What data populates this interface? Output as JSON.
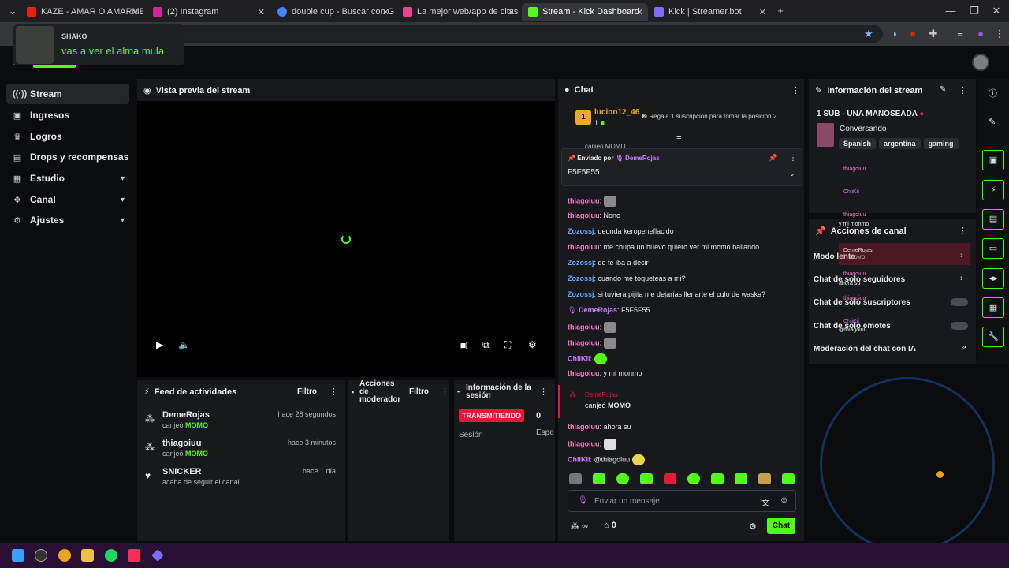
{
  "browser": {
    "tabs": [
      {
        "label": "KAZE - AMAR O AMARME [PRO",
        "color": "#e62117"
      },
      {
        "label": "(2) Instagram",
        "color": "#d6249f"
      },
      {
        "label": "double cup - Buscar con Googl",
        "color": "#4285f4"
      },
      {
        "label": "La mejor web/app de citas grat",
        "color": "#e84393"
      },
      {
        "label": "Stream - Kick Dashboard",
        "color": "#53fc18"
      },
      {
        "label": "Kick | Streamer.bot",
        "color": "#7c6cf7"
      }
    ]
  },
  "notification": {
    "user": "SHAKO",
    "message": "vas a ver el alma mula"
  },
  "sidebar": {
    "items": [
      {
        "label": "Stream",
        "icon": "broadcast-icon"
      },
      {
        "label": "Ingresos",
        "icon": "wallet-icon"
      },
      {
        "label": "Logros",
        "icon": "trophy-icon"
      },
      {
        "label": "Drops y recompensas",
        "icon": "gift-icon"
      },
      {
        "label": "Estudio",
        "icon": "studio-icon"
      },
      {
        "label": "Canal",
        "icon": "channel-icon"
      },
      {
        "label": "Ajustes",
        "icon": "gear-icon"
      }
    ]
  },
  "preview": {
    "title": "Vista previa del stream"
  },
  "feed": {
    "title": "Feed de actividades",
    "filter": "Filtro",
    "rows": [
      {
        "name": "DemeRojas",
        "action": "canjeó",
        "reward": "MOMO",
        "time": "hace 28 segundos"
      },
      {
        "name": "thiagoiuu",
        "action": "canjeó",
        "reward": "MOMO",
        "time": "hace 3 minutos"
      },
      {
        "name": "SNICKER",
        "action": "acaba de seguir el canal",
        "reward": "",
        "time": "hace 1 día"
      }
    ]
  },
  "mod_actions": {
    "title_1": "Acciones",
    "title_2": "de",
    "title_3": "moderador",
    "filter": "Filtro"
  },
  "session": {
    "title_1": "Información de la",
    "title_2": "sesión",
    "status": "TRANSMITIENDO",
    "count": "0",
    "label": "Sesión",
    "extra": "Espe"
  },
  "chat": {
    "title": "Chat",
    "top_user": "lucioo12_46",
    "top_rank": "1",
    "top_count": "1",
    "gift_prompt": "Regala 1 suscripción para tomar la posición 2",
    "partial_top": "canjeó MOMO",
    "pinned_by_label": "Enviado por",
    "pinned_by": "DemeRojas",
    "pinned_message": "F5F5F55",
    "messages": [
      {
        "user": "thiagoiuu",
        "text": "",
        "color": "pink",
        "emote": "#8a8a8a"
      },
      {
        "user": "thiagoiuu",
        "text": "Nono",
        "color": "pink",
        "emote": ""
      },
      {
        "user": "Zozossj",
        "text": "qeonda keropeneflacido",
        "color": "blue",
        "emote": ""
      },
      {
        "user": "thiagoiuu",
        "text": "me chupa un huevo quiero ver mi momo bailando",
        "color": "pink",
        "emote": ""
      },
      {
        "user": "Zozossj",
        "text": "qe te iba a decir",
        "color": "blue",
        "emote": ""
      },
      {
        "user": "Zozossj",
        "text": "cuando me toqueteas a mi?",
        "color": "blue",
        "emote": ""
      },
      {
        "user": "Zozossj",
        "text": "si tuviera pijita me dejarías llenarte el culo de waska?",
        "color": "blue",
        "emote": ""
      },
      {
        "user": "DemeRojas",
        "text": "F5F5F55",
        "color": "purple",
        "emote": ""
      },
      {
        "user": "thiagoiuu",
        "text": "",
        "color": "pink",
        "emote": "#8a8a8a"
      },
      {
        "user": "thiagoiuu",
        "text": "",
        "color": "pink",
        "emote": "#8a8a8a"
      },
      {
        "user": "ChiiKii",
        "text": "",
        "color": "purple",
        "emote": "#53fc18"
      },
      {
        "user": "thiagoiuu",
        "text": "y mi monmo",
        "color": "pink",
        "emote": ""
      }
    ],
    "redeem": {
      "user": "DemeRojas",
      "action": "canjeó",
      "reward": "MOMO"
    },
    "messages2": [
      {
        "user": "thiagoiuu",
        "text": "ahora su",
        "color": "pink",
        "emote": ""
      },
      {
        "user": "thiagoiuu",
        "text": "",
        "color": "pink",
        "emote": "#dddddd"
      },
      {
        "user": "ChiiKii",
        "text": "@thiagoiuu",
        "color": "purple",
        "emote": "#e6d64a"
      }
    ],
    "input_placeholder": "Enviar un mensaje",
    "viewers": "∞",
    "store_count": "0",
    "send_label": "Chat"
  },
  "stream_info": {
    "title": "Información del stream",
    "stream_title": "1 SUB - UNA MANOSEADA",
    "category": "Conversando",
    "tags": [
      "Spanish",
      "argentina",
      "gaming"
    ]
  },
  "channel_actions": {
    "title": "Acciones de canal",
    "rows": [
      "Modo lento",
      "Chat de solo seguidores",
      "Chat de solo suscriptores",
      "Chat de solo emotes",
      "Moderación del chat con IA"
    ]
  },
  "overlay_chat": [
    {
      "user": "thiagoiuu",
      "text": ""
    },
    {
      "user": "ChiiKii",
      "text": ""
    },
    {
      "user": "thiagoiuu",
      "text": "y mi monmo"
    },
    {
      "user": "DemeRojas",
      "text": "MOMO"
    },
    {
      "user": "thiagoiuu",
      "text": "ahora su"
    },
    {
      "user": "thiagoiuu",
      "text": ""
    },
    {
      "user": "ChiiKii",
      "text": "@thiagoiuu"
    }
  ]
}
